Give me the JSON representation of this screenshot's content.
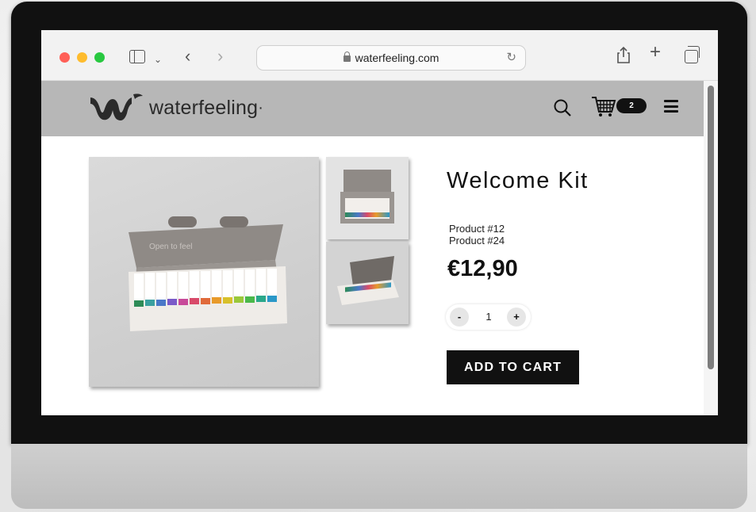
{
  "browser": {
    "url": "waterfeeling.com"
  },
  "site": {
    "logo_text": "waterfeeling",
    "logo_mark": "·",
    "cart_count": "2"
  },
  "product": {
    "title": "Welcome Kit",
    "variants": [
      "Product #12",
      "Product #24"
    ],
    "price": "€12,90",
    "quantity": "1",
    "qty_minus": "-",
    "qty_plus": "+",
    "add_to_cart": "ADD TO CART",
    "image_box_text": "Open to feel"
  },
  "icons": {
    "sidebar": "sidebar-icon",
    "back": "back-icon",
    "forward": "forward-icon",
    "share": "share-icon",
    "new_tab": "plus-icon",
    "tabs": "tabs-icon",
    "search": "search-icon",
    "cart": "cart-icon",
    "menu": "menu-icon"
  },
  "colors": {
    "header_bg": "#b7b7b7",
    "button_bg": "#111111",
    "traffic_red": "#ff5f57",
    "traffic_yellow": "#febc2e",
    "traffic_green": "#28c840"
  }
}
